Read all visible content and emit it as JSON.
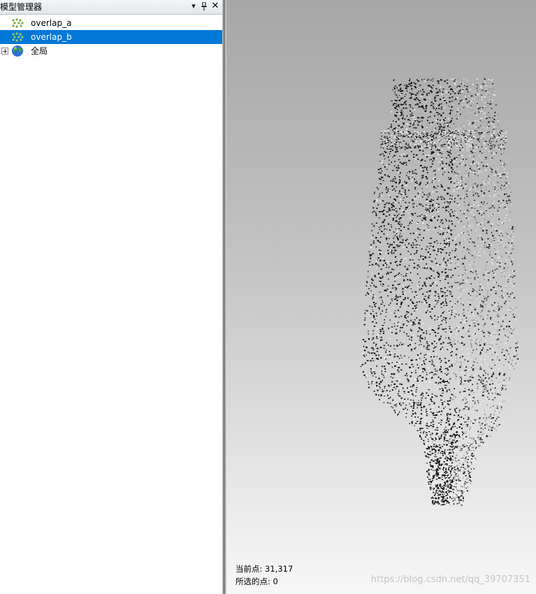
{
  "panel": {
    "title": "模型管理器",
    "pin_icon": "pin-icon",
    "menu_icon": "dropdown-arrow-icon",
    "close_icon": "close-icon"
  },
  "tree": {
    "items": [
      {
        "label": "overlap_a",
        "icon": "point-cloud-icon",
        "selected": false
      },
      {
        "label": "overlap_b",
        "icon": "point-cloud-icon",
        "selected": true
      },
      {
        "label": "全局",
        "icon": "globe-icon",
        "selected": false,
        "expandable": true
      }
    ]
  },
  "viewport": {
    "current_points": "当前点: 31,317",
    "selected_points": "所选的点: 0",
    "watermark": "https://blog.csdn.net/qq_39707351"
  },
  "colors": {
    "selection": "#0078d7",
    "viewport_top": "#a6a6a6",
    "viewport_bottom": "#f7f7f7"
  }
}
